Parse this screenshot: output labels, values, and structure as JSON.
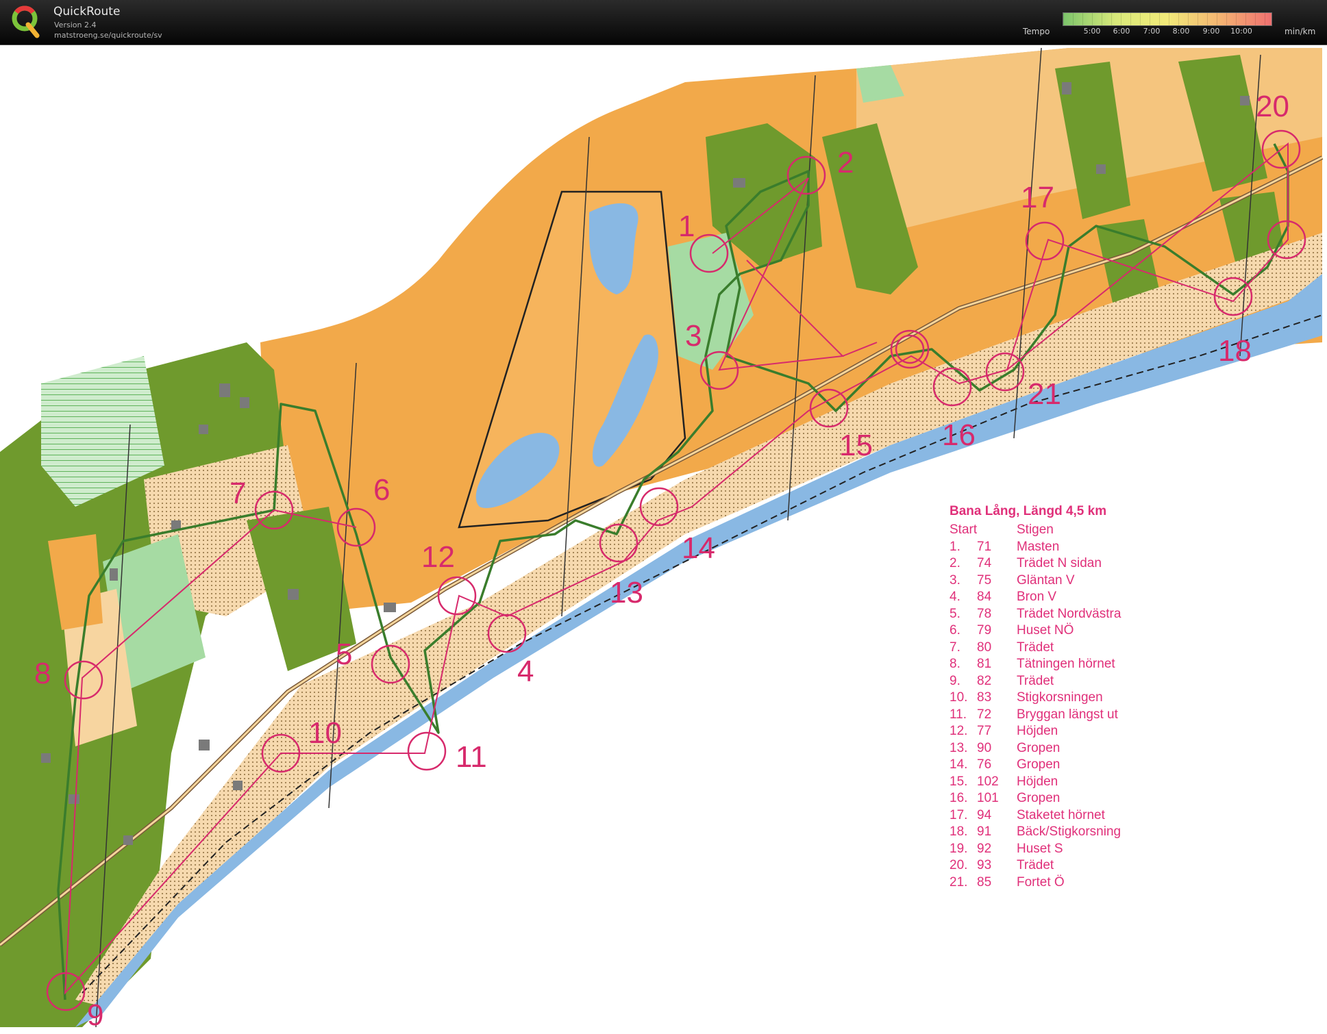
{
  "app": {
    "title": "QuickRoute",
    "version": "Version 2.4",
    "url": "matstroeng.se/quickroute/sv"
  },
  "tempo": {
    "label": "Tempo",
    "ticks": [
      "5:00",
      "6:00",
      "7:00",
      "8:00",
      "9:00",
      "10:00"
    ],
    "unit": "min/km",
    "gradient_colors": [
      "#7cc46b",
      "#d8e97a",
      "#f2ea7a",
      "#f4b572",
      "#ef7070"
    ]
  },
  "map": {
    "control_numbers": [
      "1",
      "2",
      "3",
      "4",
      "5",
      "6",
      "7",
      "8",
      "9",
      "10",
      "11",
      "12",
      "13",
      "14",
      "15",
      "16",
      "17",
      "18",
      "20",
      "21"
    ],
    "colors": {
      "open_land": "#f2a94a",
      "forest": "#6f9a2d",
      "green_light": "#a6dba3",
      "water": "#89b8e3",
      "course": "#d72a6c",
      "route": "#3a7d2c"
    }
  },
  "legend": {
    "title": "Bana Lång,  Längd 4,5 km",
    "header": {
      "left": "Start",
      "right": "Stigen"
    },
    "rows": [
      {
        "n": "1.",
        "code": "71",
        "name": "Masten"
      },
      {
        "n": "2.",
        "code": "74",
        "name": "Trädet N sidan"
      },
      {
        "n": "3.",
        "code": "75",
        "name": "Gläntan V"
      },
      {
        "n": "4.",
        "code": "84",
        "name": "Bron V"
      },
      {
        "n": "5.",
        "code": "78",
        "name": "Trädet Nordvästra"
      },
      {
        "n": "6.",
        "code": "79",
        "name": "Huset NÖ"
      },
      {
        "n": "7.",
        "code": "80",
        "name": "Trädet"
      },
      {
        "n": "8.",
        "code": "81",
        "name": "Tätningen hörnet"
      },
      {
        "n": "9.",
        "code": "82",
        "name": "Trädet"
      },
      {
        "n": "10.",
        "code": "83",
        "name": "Stigkorsningen"
      },
      {
        "n": "11.",
        "code": "72",
        "name": "Bryggan längst ut"
      },
      {
        "n": "12.",
        "code": "77",
        "name": "Höjden"
      },
      {
        "n": "13.",
        "code": "90",
        "name": "Gropen"
      },
      {
        "n": "14.",
        "code": "76",
        "name": "Gropen"
      },
      {
        "n": "15.",
        "code": "102",
        "name": "Höjden"
      },
      {
        "n": "16.",
        "code": "101",
        "name": "Gropen"
      },
      {
        "n": "17.",
        "code": "94",
        "name": "Staketet hörnet"
      },
      {
        "n": "18.",
        "code": "91",
        "name": "Bäck/Stigkorsning"
      },
      {
        "n": "19.",
        "code": "92",
        "name": "Huset S"
      },
      {
        "n": "20.",
        "code": "93",
        "name": "Trädet"
      },
      {
        "n": "21.",
        "code": "85",
        "name": "Fortet Ö"
      }
    ]
  }
}
